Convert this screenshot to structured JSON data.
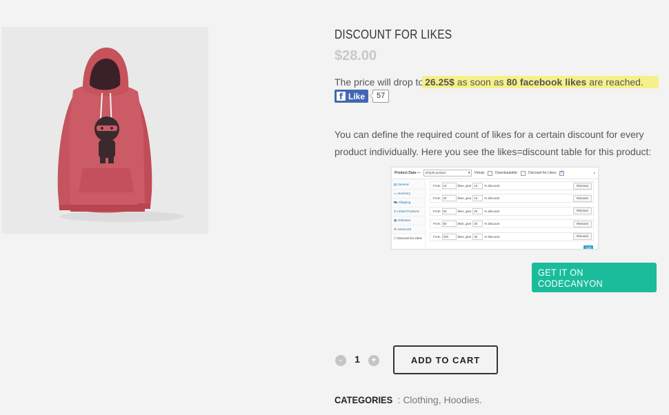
{
  "product": {
    "title": "DISCOUNT FOR LIKES",
    "price": "$28.00",
    "image_alt": "Red hoodie with ninja print"
  },
  "promo": {
    "prefix": "The price will drop to",
    "new_price": "26.25$",
    "middle": "as soon as",
    "likes_goal": "80 facebook likes",
    "suffix": "are reached."
  },
  "facebook": {
    "like_label": "Like",
    "like_count": "57"
  },
  "description": "You can define the required count of likes for a certain discount for every product individually. Here you see the likes=discount table for this product:",
  "admin_screenshot": {
    "panel_title": "Product Data —",
    "product_type": "Simple product",
    "virtual_label": "Virtual:",
    "downloadable_label": "Downloadable:",
    "discount_label": "Discount for Likes:",
    "tabs": [
      "General",
      "Inventory",
      "Shipping",
      "Linked Products",
      "Attributes",
      "Advanced",
      "Discount for Likes"
    ],
    "row_from": "From",
    "row_likes_give": "likes, give",
    "row_discount": "% discount",
    "remove_label": "Remove",
    "add_label": "Add",
    "rows": [
      {
        "likes": "10",
        "discount": "10"
      },
      {
        "likes": "20",
        "discount": "15"
      },
      {
        "likes": "50",
        "discount": "20"
      },
      {
        "likes": "80",
        "discount": "25"
      },
      {
        "likes": "200",
        "discount": "30"
      }
    ]
  },
  "cta": {
    "codecanyon_label": "GET IT ON CODECANYON",
    "color": "#1abc9c"
  },
  "cart": {
    "minus": "-",
    "plus": "+",
    "quantity": "1",
    "add_to_cart_label": "ADD TO CART"
  },
  "categories": {
    "label": "CATEGORIES",
    "items": [
      "Clothing",
      "Hoodies"
    ]
  }
}
